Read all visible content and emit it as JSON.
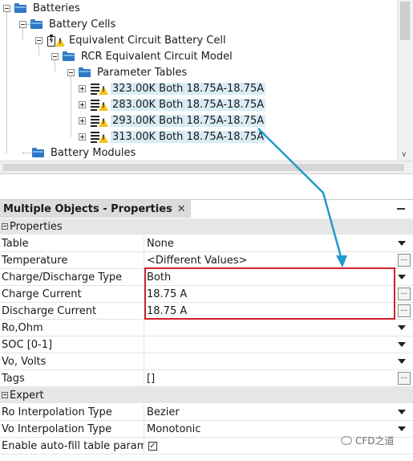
{
  "tree": {
    "items": [
      {
        "label": "Batteries",
        "icon": "folder-icon"
      },
      {
        "label": "Battery Cells",
        "icon": "folder-icon"
      },
      {
        "label": "Equivalent Circuit Battery Cell",
        "icon": "battery-icon"
      },
      {
        "label": "RCR Equivalent Circuit Model",
        "icon": "folder-icon"
      },
      {
        "label": "Parameter Tables",
        "icon": "folder-icon"
      },
      {
        "label": "323.00K Both 18.75A-18.75A",
        "icon": "table-icon"
      },
      {
        "label": "283.00K Both 18.75A-18.75A",
        "icon": "table-icon"
      },
      {
        "label": "293.00K Both 18.75A-18.75A",
        "icon": "table-icon"
      },
      {
        "label": "313.00K Both 18.75A-18.75A",
        "icon": "table-icon"
      },
      {
        "label": "Battery Modules",
        "icon": "folder-icon"
      }
    ]
  },
  "properties": {
    "tab_title": "Multiple Objects - Properties",
    "close_glyph": "✕",
    "sections": [
      {
        "title": "Properties",
        "rows": [
          {
            "name": "Table",
            "value": "None",
            "control": "dropdown"
          },
          {
            "name": "Temperature",
            "value": "<Different Values>",
            "control": "ellipsis"
          },
          {
            "name": "Charge/Discharge Type",
            "value": "Both",
            "control": "dropdown"
          },
          {
            "name": "Charge Current",
            "value": "18.75 A",
            "control": "ellipsis"
          },
          {
            "name": "Discharge Current",
            "value": "18.75 A",
            "control": "ellipsis"
          },
          {
            "name": "Ro,Ohm",
            "value": "",
            "control": "dropdown"
          },
          {
            "name": "SOC [0-1]",
            "value": "",
            "control": "dropdown"
          },
          {
            "name": "Vo, Volts",
            "value": "",
            "control": "dropdown"
          },
          {
            "name": "Tags",
            "value": "[]",
            "control": "ellipsis"
          }
        ]
      },
      {
        "title": "Expert",
        "rows": [
          {
            "name": "Ro Interpolation Type",
            "value": "Bezier",
            "control": "dropdown"
          },
          {
            "name": "Vo Interpolation Type",
            "value": "Monotonic",
            "control": "dropdown"
          },
          {
            "name": "Enable auto-fill table parame",
            "value": "✓",
            "control": "checkbox"
          }
        ]
      }
    ]
  },
  "watermark": "CFD之道",
  "colors": {
    "selection": "#d8ecf5",
    "annotation_red": "#d0232a",
    "annotation_arrow": "#1f9bd1",
    "folder_blue": "#2f77c6",
    "warning_yellow": "#f2c21b"
  }
}
